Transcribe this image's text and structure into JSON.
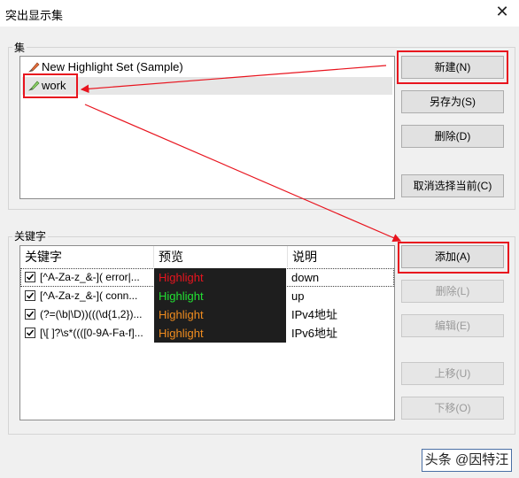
{
  "window": {
    "title": "突出显示集"
  },
  "sets_group": {
    "label": "集",
    "items": [
      {
        "label": "New Highlight Set (Sample)",
        "selected": false
      },
      {
        "label": "work",
        "selected": true
      }
    ]
  },
  "buttons": {
    "new": "新建(N)",
    "save_as": "另存为(S)",
    "delete_set": "删除(D)",
    "deselect": "取消选择当前(C)",
    "add": "添加(A)",
    "delete_kw": "删除(L)",
    "edit": "编辑(E)",
    "move_up": "上移(U)",
    "move_down": "下移(O)"
  },
  "keywords_group": {
    "label": "关键字",
    "columns": [
      "关键字",
      "预览",
      "说明"
    ],
    "rows": [
      {
        "checked": true,
        "keyword": "[^A-Za-z_&-]( error|...",
        "preview": "Highlight",
        "preview_color": "#e8141e",
        "desc": "down"
      },
      {
        "checked": true,
        "keyword": "[^A-Za-z_&-]( conn...",
        "preview": "Highlight",
        "preview_color": "#22e033",
        "desc": "up"
      },
      {
        "checked": true,
        "keyword": "(?=(\\b|\\D))(((\\d{1,2})...",
        "preview": "Highlight",
        "preview_color": "#f08c1e",
        "desc": "IPv4地址"
      },
      {
        "checked": true,
        "keyword": "[\\[ ]?\\s*((([0-9A-Fa-f]...",
        "preview": "Highlight",
        "preview_color": "#f08c1e",
        "desc": "IPv6地址"
      }
    ]
  },
  "watermark": {
    "text": "头条 @因特汪"
  },
  "colors": {
    "annotation_red": "#e8141e",
    "dialog_bg": "#f0f0f0"
  }
}
